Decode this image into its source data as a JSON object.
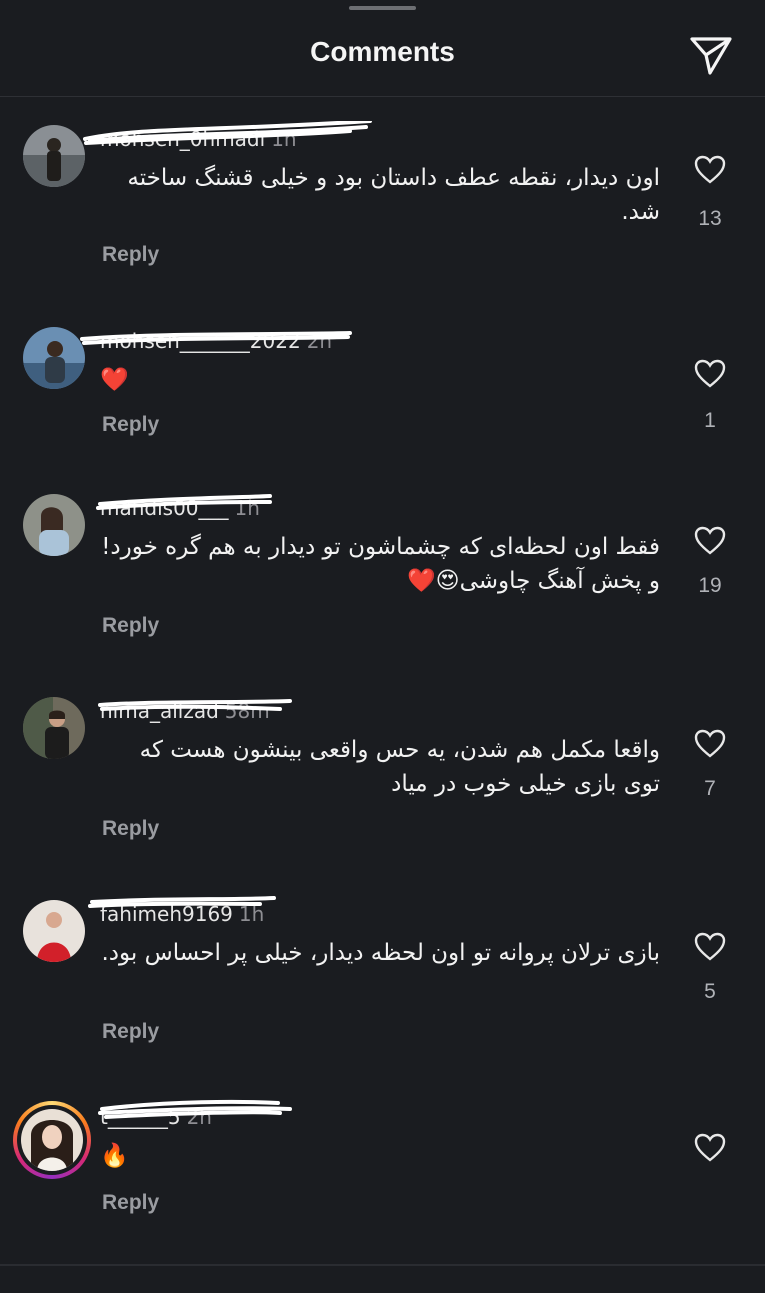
{
  "header": {
    "title": "Comments",
    "send_icon": "send-icon"
  },
  "comments": [
    {
      "username": "mohsen_0hmadi",
      "time": "1h",
      "text": "اون دیدار، نقطه عطف داستان بود و خیلی قشنگ ساخته شد.",
      "likes": "13",
      "reply_label": "Reply"
    },
    {
      "username": "mohsen_______2022",
      "time": "2h",
      "text": "❤️",
      "likes": "1",
      "reply_label": "Reply"
    },
    {
      "username": "mahdis00___",
      "time": "1h",
      "text": "فقط اون لحظه‌ای که چشماشون تو دیدار به هم گره خورد!و پخش آهنگ چاوشی😍❤️",
      "likes": "19",
      "reply_label": "Reply"
    },
    {
      "username": "nima_alizad",
      "time": "58m",
      "text": "واقعا مکمل هم شدن، یه حس واقعی بینشون هست که توی بازی خیلی خوب در میاد",
      "likes": "7",
      "reply_label": "Reply"
    },
    {
      "username": "fahimeh9169",
      "time": "1h",
      "text": "بازی ترلان پروانه تو اون لحظه دیدار، خیلی پر احساس بود.",
      "likes": "5",
      "reply_label": "Reply"
    },
    {
      "username": "t______5",
      "time": "2h",
      "text": "🔥",
      "likes": "",
      "reply_label": "Reply"
    }
  ],
  "colors": {
    "background": "#1a1c20",
    "text": "#f5f5f5",
    "muted": "#9a9ca1",
    "story_ring": "#e1306c"
  }
}
